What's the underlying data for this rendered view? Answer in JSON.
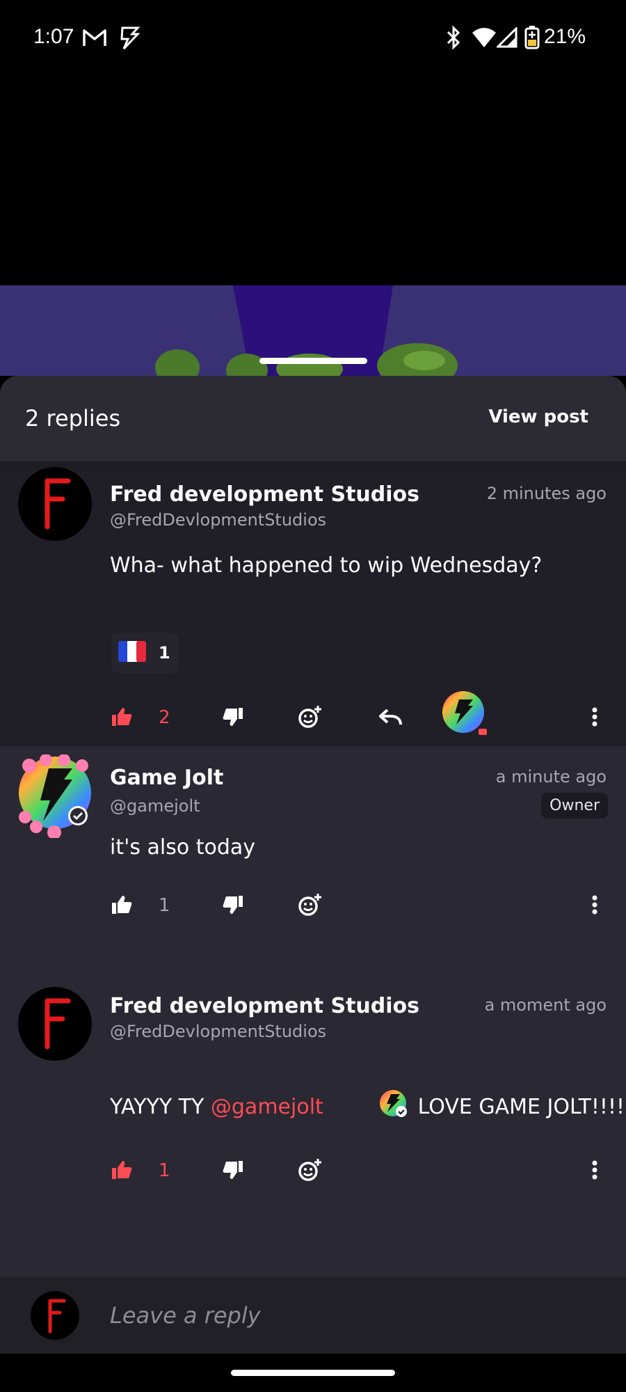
{
  "status_bar": {
    "time": "1:07",
    "battery": "21%",
    "icons": [
      "gmail-icon",
      "gamejolt-notification-icon",
      "bluetooth-icon",
      "wifi-icon",
      "signal-icon",
      "battery-icon"
    ]
  },
  "sheet": {
    "title": "2 replies",
    "view_post": "View post"
  },
  "comments": [
    {
      "author": "Fred development Studios",
      "handle": "@FredDevlopmentStudios",
      "time": "2 minutes ago",
      "text": "Wha- what happened to wip Wednesday?",
      "reaction": {
        "icon": "france-flag-icon",
        "count": "1"
      },
      "likes": "2",
      "liked": true
    },
    {
      "author": "Game Jolt",
      "handle": "@gamejolt",
      "time": "a minute ago",
      "badge": "Owner",
      "text": "it's also today",
      "likes": "1",
      "liked": false
    },
    {
      "author": "Fred development Studios",
      "handle": "@FredDevlopmentStudios",
      "time": "a moment ago",
      "text_before": "YAYYY TY ",
      "mention": "@gamejolt",
      "text_after": " LOVE GAME JOLT!!!!",
      "likes": "1",
      "liked": true
    }
  ],
  "footer": {
    "placeholder": "Leave a reply"
  },
  "colors": {
    "accent_red": "#ff4b55",
    "sheet_bg": "#2a2832",
    "highlighted_bg": "#201e26"
  }
}
